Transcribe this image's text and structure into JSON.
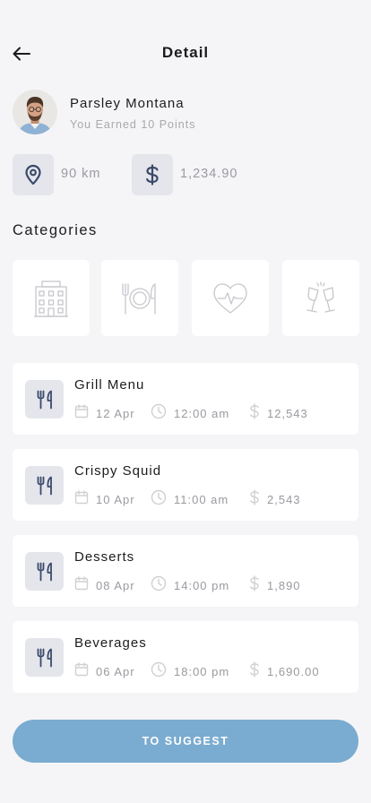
{
  "header": {
    "title": "Detail"
  },
  "profile": {
    "name": "Parsley Montana",
    "subtitle": "You Earned 10 Points"
  },
  "stats": {
    "distance": "90 km",
    "amount": "1,234.90"
  },
  "categories": {
    "title": "Categories",
    "items": [
      {
        "icon": "building-icon"
      },
      {
        "icon": "plate-cutlery-icon"
      },
      {
        "icon": "heart-pulse-icon"
      },
      {
        "icon": "champagne-glasses-icon"
      }
    ]
  },
  "menus": [
    {
      "title": "Grill Menu",
      "date": "12 Apr",
      "time": "12:00 am",
      "price": "12,543"
    },
    {
      "title": "Crispy Squid",
      "date": "10 Apr",
      "time": "11:00 am",
      "price": "2,543"
    },
    {
      "title": "Desserts",
      "date": "08 Apr",
      "time": "14:00 pm",
      "price": "1,890"
    },
    {
      "title": "Beverages",
      "date": "06 Apr",
      "time": "18:00 pm",
      "price": "1,690.00"
    }
  ],
  "cta": {
    "label": "TO SUGGEST"
  },
  "colors": {
    "accent": "#7aabd0",
    "icon_dark": "#3b4a6b",
    "background": "#f5f5f7"
  }
}
